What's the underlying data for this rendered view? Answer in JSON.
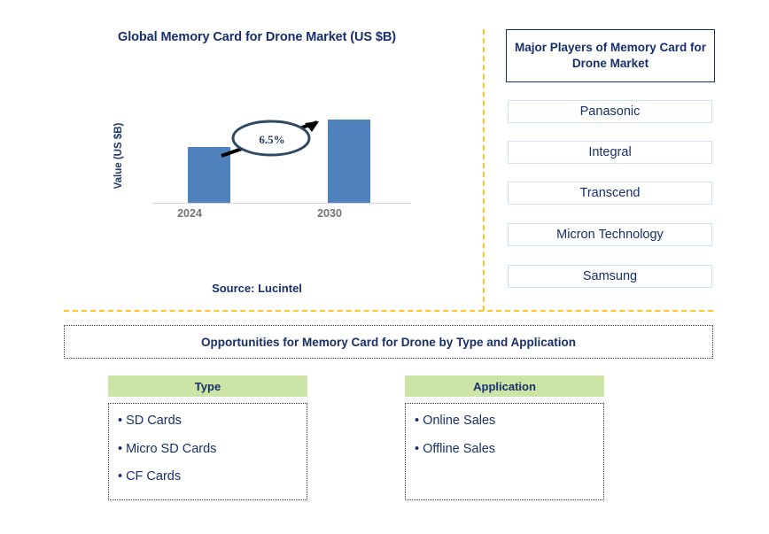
{
  "chart": {
    "title": "Global Memory Card for Drone Market (US $B)",
    "y_axis_label": "Value (US $B)",
    "cagr_label": "6.5%",
    "source": "Source: Lucintel",
    "bar_color": "#4f81bd"
  },
  "chart_data": {
    "type": "bar",
    "title": "Global Memory Card for Drone Market (US $B)",
    "categories": [
      "2024",
      "2030"
    ],
    "values": [
      52,
      77
    ],
    "xlabel": "",
    "ylabel": "Value (US $B)",
    "ylim": [
      0,
      100
    ],
    "grid": false,
    "legend": "none",
    "annotations": [
      {
        "text": "6.5%",
        "type": "cagr-callout",
        "from": "2024",
        "to": "2030"
      }
    ],
    "series": [
      {
        "name": "Value (US $B)",
        "values": [
          52,
          77
        ]
      }
    ],
    "source": "Source: Lucintel"
  },
  "players": {
    "header": "Major Players of Memory Card for Drone Market",
    "items": [
      "Panasonic",
      "Integral",
      "Transcend",
      "Micron Technology",
      "Samsung"
    ]
  },
  "opportunities": {
    "banner": "Opportunities for Memory Card for Drone by Type and Application",
    "columns": [
      {
        "header": "Type",
        "items": [
          "SD Cards",
          "Micro SD Cards",
          "CF Cards"
        ]
      },
      {
        "header": "Application",
        "items": [
          "Online Sales",
          "Offline Sales"
        ]
      }
    ],
    "bullet_glyph": "•",
    "header_color": "#cce5a6"
  },
  "theme": {
    "navy": "#17306b",
    "gold_divider": "#ffc425",
    "bar_blue": "#4f81bd"
  }
}
